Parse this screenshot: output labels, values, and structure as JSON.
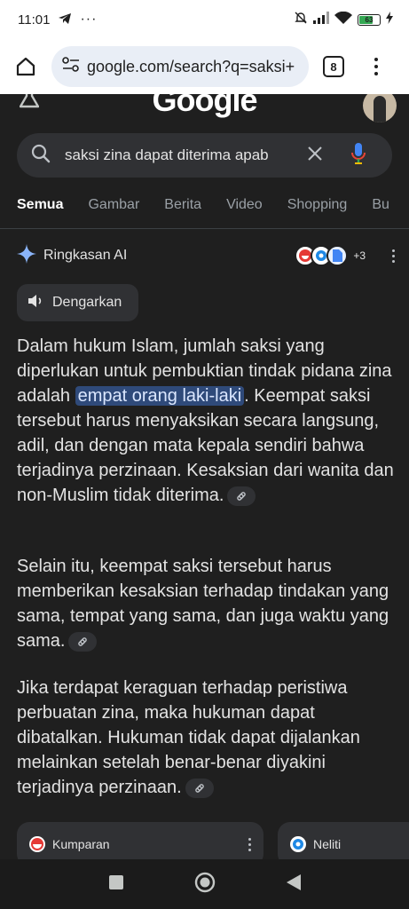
{
  "status_bar": {
    "time": "11:01",
    "battery": "63"
  },
  "browser": {
    "url": "google.com/search?q=saksi+",
    "tab_count": "8"
  },
  "search": {
    "query": "saksi zina dapat diterima apab"
  },
  "tabs": [
    {
      "label": "Semua",
      "active": true
    },
    {
      "label": "Gambar"
    },
    {
      "label": "Berita"
    },
    {
      "label": "Video"
    },
    {
      "label": "Shopping"
    },
    {
      "label": "Bu"
    }
  ],
  "ai_overview": {
    "title": "Ringkasan AI",
    "more_sources": "+3",
    "listen_label": "Dengarkan",
    "para1_before": "Dalam hukum Islam, jumlah saksi yang diperlukan untuk pembuktian tindak pidana zina adalah ",
    "para1_highlight": "empat orang laki-laki",
    "para1_after": ". Keempat saksi tersebut harus menyaksikan secara langsung, adil, dan dengan mata kepala sendiri bahwa terjadinya perzinaan. Kesaksian dari wanita dan non-Muslim tidak diterima.",
    "para2": "Selain itu, keempat saksi tersebut harus memberikan kesaksian terhadap tindakan yang sama, tempat yang sama, dan juga waktu yang sama.",
    "para3": "Jika terdapat keraguan terhadap peristiwa perbuatan zina, maka hukuman dapat dibatalkan. Hukuman tidak dapat dijalankan melainkan setelah benar-benar diyakini terjadinya perzinaan."
  },
  "source_cards": [
    {
      "name": "Kumparan"
    },
    {
      "name": "Neliti"
    }
  ],
  "colors": {
    "background": "#1f1f1f",
    "highlight": "#2f4a7a",
    "accent_blue": "#4285f4"
  }
}
